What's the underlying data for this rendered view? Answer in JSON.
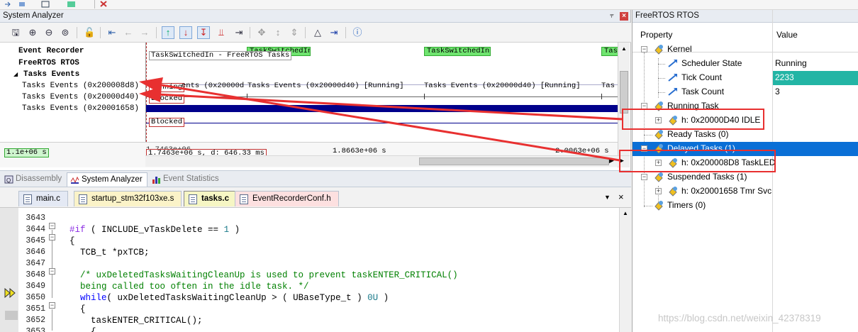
{
  "system_analyzer": {
    "title": "System Analyzer",
    "tree": {
      "event_recorder": "Event Recorder",
      "freertos": "FreeRTOS RTOS",
      "tasks_events": "Tasks Events",
      "task_rows": [
        "Tasks Events (0x200008d8)",
        "Tasks Events (0x20000d40)",
        "Tasks Events (0x20001658)"
      ]
    },
    "graph": {
      "green_boxes": [
        "TaskSwitchedIn",
        "TaskSwitchedIn",
        "TaskSwitchedIn",
        "Tas"
      ],
      "tooltip": "TaskSwitchedIn - FreeRTOS Tasks",
      "row_running_label": "Running",
      "row_ents": "ents (0x20000d",
      "events_label_1": "Tasks Events (0x20000d40) [Running]",
      "events_label_2": "Tasks Events (0x20000d40) [Running]",
      "events_tail": "Tas",
      "blocked_1": "Blocked",
      "blocked_3": "Blocked"
    },
    "time": {
      "left": "1.1e+06 s",
      "cursor": "1.7463e+06 s,  d: 646.33 ms",
      "cursor_top": "1.7463e+06",
      "mid": "1.8663e+06 s",
      "right": "2.0063e+06 s"
    }
  },
  "analyzer_tabs": [
    "Disassembly",
    "System Analyzer",
    "Event Statistics"
  ],
  "editor_tabs": [
    "main.c",
    "startup_stm32f103xe.s",
    "tasks.c",
    "EventRecorderConf.h"
  ],
  "code": {
    "line_numbers": [
      "3643",
      "3644",
      "3645",
      "3646",
      "3647",
      "3648",
      "3649",
      "3650",
      "3651",
      "3652",
      "3653"
    ],
    "l3644_pp": "#if",
    "l3644_rest": " ( INCLUDE_vTaskDelete == ",
    "l3644_num": "1",
    "l3644_end": " )",
    "l3645": "{",
    "l3646": "  TCB_t *pxTCB;",
    "l3648": "  /* uxDeletedTasksWaitingCleanUp is used to prevent taskENTER_CRITICAL()",
    "l3649": "  being called too often in the idle task. */",
    "l3650_kw": "while",
    "l3650_rest": "( uxDeletedTasksWaitingCleanUp > ( UBaseType_t ) ",
    "l3650_num": "0U",
    "l3650_end": " )",
    "l3651": "  {",
    "l3652": "    taskENTER_CRITICAL();",
    "l3653": "    {"
  },
  "rtos": {
    "title": "FreeRTOS RTOS",
    "col_property": "Property",
    "col_value": "Value",
    "kernel": "Kernel",
    "scheduler_state": "Scheduler State",
    "scheduler_state_val": "Running",
    "tick_count": "Tick Count",
    "tick_count_val": "2233",
    "task_count": "Task Count",
    "task_count_val": "3",
    "running_task": "Running Task",
    "running_item": "h: 0x20000D40 IDLE",
    "ready_tasks": "Ready Tasks (0)",
    "delayed_tasks": "Delayed Tasks (1)",
    "delayed_item": "h: 0x200008D8 TaskLED",
    "suspended_tasks": "Suspended Tasks (1)",
    "suspended_item": "h: 0x20001658 Tmr Svc",
    "timers": "Timers (0)"
  },
  "watermark": "https://blog.csdn.net/weixin_42378319",
  "colors": {
    "annotation_red": "#e83030",
    "selection_blue": "#0a6fd6",
    "tick_highlight": "#23b5a5",
    "running_bar": "#00008b"
  }
}
